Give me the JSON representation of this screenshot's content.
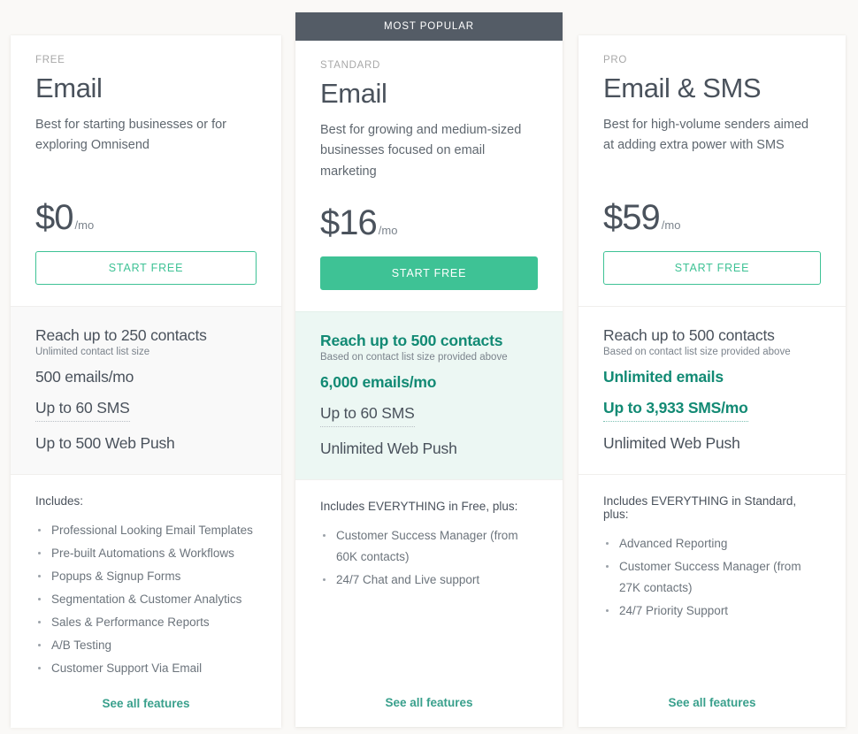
{
  "background_color": "#faf9f7",
  "accent_green": "#3ec295",
  "accent_teal": "#128a74",
  "link_teal": "#39a08c",
  "banner_gray": "#545c66",
  "plans": [
    {
      "tier": "FREE",
      "name": "Email",
      "description": "Best for starting businesses or for exploring Omnisend",
      "price": "$0",
      "period": "/mo",
      "cta_label": "START FREE",
      "cta_style": "outline",
      "badge": null,
      "quota": {
        "headline": "Reach up to 250 contacts",
        "headline_accent": false,
        "sub": "Unlimited contact list size",
        "lines": [
          {
            "text": "500 emails/mo",
            "accent": false,
            "dotted": false
          },
          {
            "text": "Up to 60 SMS",
            "accent": false,
            "dotted": true
          },
          {
            "text": "Up to 500 Web Push",
            "accent": false,
            "dotted": false
          }
        ]
      },
      "includes_title": "Includes:",
      "features": [
        "Professional Looking Email Templates",
        "Pre-built Automations & Workflows",
        "Popups & Signup Forms",
        "Segmentation & Customer Analytics",
        "Sales & Performance Reports",
        "A/B Testing",
        "Customer Support Via Email"
      ],
      "see_all_label": "See all features"
    },
    {
      "tier": "STANDARD",
      "name": "Email",
      "description": "Best for growing and medium-sized businesses focused on email marketing",
      "price": "$16",
      "period": "/mo",
      "cta_label": "START FREE",
      "cta_style": "filled",
      "badge": "MOST POPULAR",
      "quota": {
        "headline": "Reach up to 500 contacts",
        "headline_accent": true,
        "sub": "Based on contact list size provided above",
        "lines": [
          {
            "text": "6,000 emails/mo",
            "accent": true,
            "dotted": false
          },
          {
            "text": "Up to 60 SMS",
            "accent": false,
            "dotted": true
          },
          {
            "text": "Unlimited Web Push",
            "accent": false,
            "dotted": false
          }
        ]
      },
      "includes_title": "Includes EVERYTHING in Free, plus:",
      "features": [
        "Customer Success Manager (from 60K contacts)",
        "24/7 Chat and Live support"
      ],
      "see_all_label": "See all features"
    },
    {
      "tier": "PRO",
      "name": "Email & SMS",
      "description": "Best for high-volume senders aimed at adding extra power with SMS",
      "price": "$59",
      "period": "/mo",
      "cta_label": "START FREE",
      "cta_style": "outline",
      "badge": null,
      "quota": {
        "headline": "Reach up to 500 contacts",
        "headline_accent": false,
        "sub": "Based on contact list size provided above",
        "lines": [
          {
            "text": "Unlimited emails",
            "accent": true,
            "dotted": false
          },
          {
            "text": "Up to 3,933 SMS/mo",
            "accent": true,
            "dotted": true
          },
          {
            "text": "Unlimited Web Push",
            "accent": false,
            "dotted": false
          }
        ]
      },
      "includes_title": "Includes EVERYTHING in Standard, plus:",
      "features": [
        "Advanced Reporting",
        "Customer Success Manager (from 27K contacts)",
        "24/7 Priority Support"
      ],
      "see_all_label": "See all features"
    }
  ]
}
